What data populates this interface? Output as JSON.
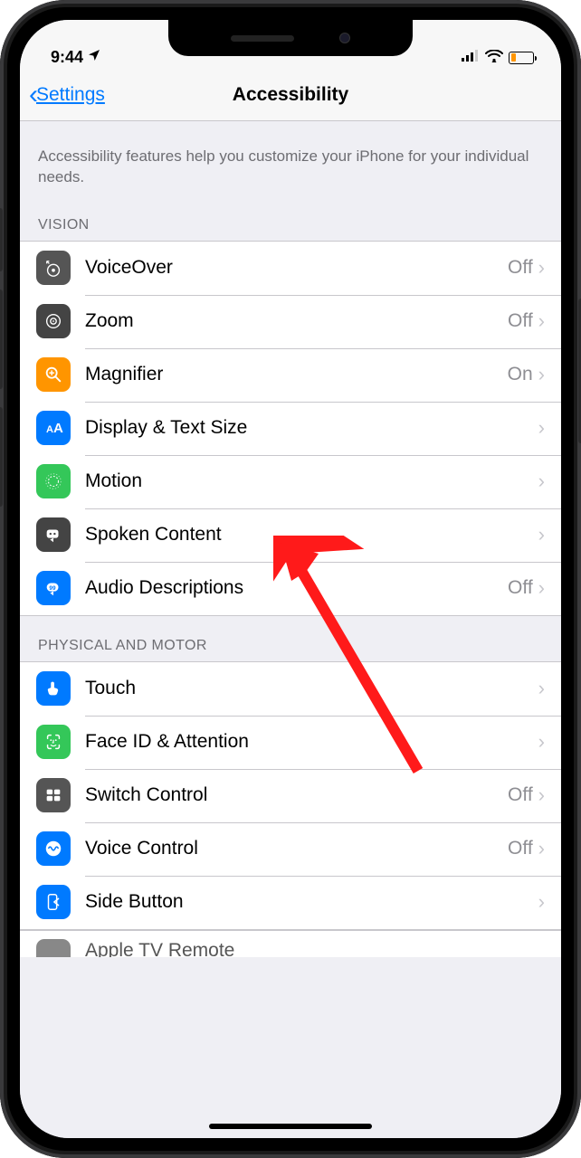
{
  "statusbar": {
    "time": "9:44"
  },
  "nav": {
    "back": "Settings",
    "title": "Accessibility"
  },
  "description": "Accessibility features help you customize your iPhone for your individual needs.",
  "sections": {
    "vision": {
      "header": "VISION",
      "items": [
        {
          "label": "VoiceOver",
          "value": "Off"
        },
        {
          "label": "Zoom",
          "value": "Off"
        },
        {
          "label": "Magnifier",
          "value": "On"
        },
        {
          "label": "Display & Text Size",
          "value": ""
        },
        {
          "label": "Motion",
          "value": ""
        },
        {
          "label": "Spoken Content",
          "value": ""
        },
        {
          "label": "Audio Descriptions",
          "value": "Off"
        }
      ]
    },
    "physical": {
      "header": "PHYSICAL AND MOTOR",
      "items": [
        {
          "label": "Touch",
          "value": ""
        },
        {
          "label": "Face ID & Attention",
          "value": ""
        },
        {
          "label": "Switch Control",
          "value": "Off"
        },
        {
          "label": "Voice Control",
          "value": "Off"
        },
        {
          "label": "Side Button",
          "value": ""
        }
      ],
      "partial_label": "Apple TV Remote"
    }
  }
}
